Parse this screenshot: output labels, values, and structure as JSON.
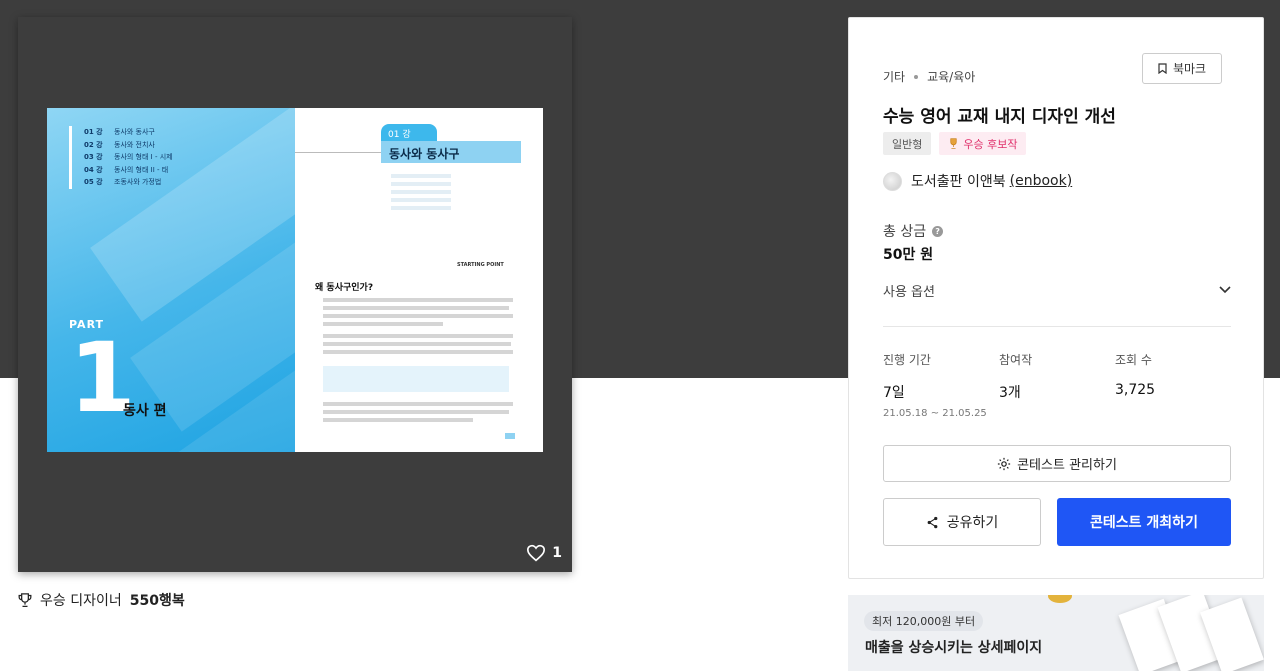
{
  "preview": {
    "toc": [
      {
        "num": "01 강",
        "label": "동사와 동사구"
      },
      {
        "num": "02 강",
        "label": "동사와 전치사"
      },
      {
        "num": "03 강",
        "label": "동사의 형태 I - 시제"
      },
      {
        "num": "04 강",
        "label": "동사의 형태 II - 태"
      },
      {
        "num": "05 강",
        "label": "조동사와 가정법"
      }
    ],
    "part_label": "PART",
    "part_number": "1",
    "part_title": "동사 편",
    "chapter_chip": "01 강",
    "chapter_title": "동사와 동사구",
    "starting_point": "STARTING POINT",
    "question": "왜 동사구인가?",
    "likes": "1"
  },
  "designer": {
    "prefix": "우승 디자이너",
    "name": "550행복"
  },
  "panel": {
    "breadcrumb": [
      "기타",
      "교육/육아"
    ],
    "bookmark_label": "북마크",
    "title": "수능 영어 교재 내지 디자인 개선",
    "badges": {
      "type": "일반형",
      "award": "우승 후보작"
    },
    "owner": {
      "name": "도서출판 이앤북",
      "handle": "(enbook)"
    },
    "prize_label": "총 상금",
    "prize_value": "50만 원",
    "options_label": "사용 옵션",
    "stats": {
      "period_label": "진행 기간",
      "period_value": "7일",
      "period_range": "21.05.18 ~ 21.05.25",
      "participants_label": "참여작",
      "participants_value": "3개",
      "views_label": "조회 수",
      "views_value": "3,725"
    },
    "manage_label": "콘테스트 관리하기",
    "share_label": "공유하기",
    "host_label": "콘테스트 개최하기"
  },
  "ad": {
    "pill": "최저 120,000원 부터",
    "headline": "매출을 상승시키는 상세페이지"
  },
  "colors": {
    "primary": "#1f56f5",
    "award": "#e0306b",
    "dark_band": "#3d3d3d",
    "book_blue": "#45b6ea"
  }
}
